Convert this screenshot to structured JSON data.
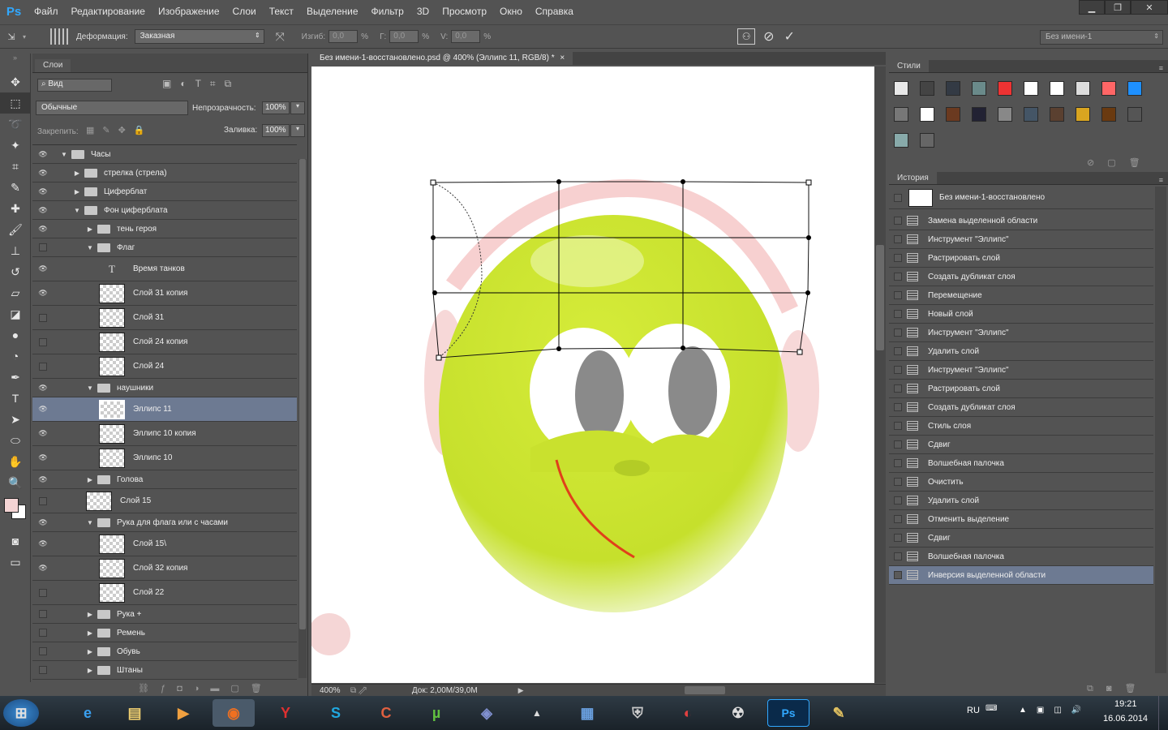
{
  "app": {
    "logo": "Ps"
  },
  "menu": [
    "Файл",
    "Редактирование",
    "Изображение",
    "Слои",
    "Текст",
    "Выделение",
    "Фильтр",
    "3D",
    "Просмотр",
    "Окно",
    "Справка"
  ],
  "options": {
    "warp_label": "Деформация:",
    "warp_value": "Заказная",
    "bend_label": "Изгиб:",
    "bend_value": "0,0",
    "h_label": "Г:",
    "h_value": "0,0",
    "v_label": "V:",
    "v_value": "0,0",
    "percent": "%",
    "workspace": "Без имени-1"
  },
  "layers_panel": {
    "tab": "Слои",
    "filter_placeholder": "Вид",
    "blend_mode": "Обычные",
    "opacity_label": "Непрозрачность:",
    "opacity_value": "100%",
    "lock_label": "Закрепить:",
    "fill_label": "Заливка:",
    "fill_value": "100%",
    "layers": [
      {
        "name": "Часы",
        "kind": "group",
        "open": true,
        "indent": 0,
        "visible": true
      },
      {
        "name": "стрелка (стрела)",
        "kind": "group",
        "open": false,
        "indent": 1,
        "visible": true
      },
      {
        "name": "Циферблат",
        "kind": "group",
        "open": false,
        "indent": 1,
        "visible": true
      },
      {
        "name": "Фон циферблата",
        "kind": "group",
        "open": true,
        "indent": 1,
        "visible": true
      },
      {
        "name": "тень героя",
        "kind": "group",
        "open": false,
        "indent": 2,
        "visible": true
      },
      {
        "name": "Флаг",
        "kind": "group",
        "open": true,
        "indent": 2,
        "visible": false
      },
      {
        "name": "Время танков",
        "kind": "text",
        "indent": 3,
        "visible": true
      },
      {
        "name": "Слой 31 копия",
        "kind": "layer",
        "indent": 3,
        "visible": true
      },
      {
        "name": "Слой 31",
        "kind": "layer",
        "indent": 3,
        "visible": false
      },
      {
        "name": "Слой 24 копия",
        "kind": "layer",
        "indent": 3,
        "visible": false
      },
      {
        "name": "Слой 24",
        "kind": "layer",
        "indent": 3,
        "visible": false
      },
      {
        "name": "наушники",
        "kind": "group",
        "open": true,
        "indent": 2,
        "visible": true
      },
      {
        "name": "Эллипс 11",
        "kind": "layer",
        "indent": 3,
        "visible": true,
        "selected": true
      },
      {
        "name": "Эллипс 10 копия",
        "kind": "layer",
        "indent": 3,
        "visible": true
      },
      {
        "name": "Эллипс 10",
        "kind": "layer",
        "indent": 3,
        "visible": true
      },
      {
        "name": "Голова",
        "kind": "group",
        "open": false,
        "indent": 2,
        "visible": true
      },
      {
        "name": "Слой 15",
        "kind": "layer",
        "indent": 2,
        "visible": false
      },
      {
        "name": "Рука для флага или с часами",
        "kind": "group",
        "open": true,
        "indent": 2,
        "visible": true
      },
      {
        "name": "Слой 15\\",
        "kind": "layer",
        "indent": 3,
        "visible": true
      },
      {
        "name": "Слой 32 копия",
        "kind": "layer",
        "indent": 3,
        "visible": true
      },
      {
        "name": "Слой 22",
        "kind": "layer",
        "indent": 3,
        "visible": false
      },
      {
        "name": "Рука +",
        "kind": "group",
        "open": false,
        "indent": 2,
        "visible": false
      },
      {
        "name": "Ремень",
        "kind": "group",
        "open": false,
        "indent": 2,
        "visible": false
      },
      {
        "name": "Обувь",
        "kind": "group",
        "open": false,
        "indent": 2,
        "visible": false
      },
      {
        "name": "Штаны",
        "kind": "group",
        "open": false,
        "indent": 2,
        "visible": false
      }
    ]
  },
  "document": {
    "tab_title": "Без имени-1-восстановлено.psd @ 400% (Эллипс 11, RGB/8) *",
    "zoom": "400%",
    "doc_info": "Док: 2,00M/39,0M"
  },
  "styles_panel": {
    "tab": "Стили",
    "swatch_colors": [
      "#e8e8e8",
      "#444",
      "#333a44",
      "#6a8a8a",
      "#e33",
      "#fff",
      "#fff",
      "#ddd",
      "#f66",
      "#1e90ff",
      "#777",
      "#fff",
      "#6b3a20",
      "#223",
      "#888",
      "#456",
      "#5a4030",
      "#d9a520",
      "#6a3a10",
      "#555",
      "#8aa",
      "#666"
    ]
  },
  "history_panel": {
    "tab": "История",
    "snapshot": "Без имени-1-восстановлено",
    "items": [
      "Замена выделенной области",
      "Инструмент \"Эллипс\"",
      "Растрировать слой",
      "Создать дубликат слоя",
      "Перемещение",
      "Новый слой",
      "Инструмент \"Эллипс\"",
      "Удалить слой",
      "Инструмент \"Эллипс\"",
      "Растрировать слой",
      "Создать дубликат слоя",
      "Стиль слоя",
      "Сдвиг",
      "Волшебная палочка",
      "Очистить",
      "Удалить слой",
      "Отменить выделение",
      "Сдвиг",
      "Волшебная палочка",
      "Инверсия выделенной области"
    ],
    "selected_index": 19
  },
  "taskbar": {
    "lang": "RU",
    "time": "19:21",
    "date": "16.06.2014"
  }
}
